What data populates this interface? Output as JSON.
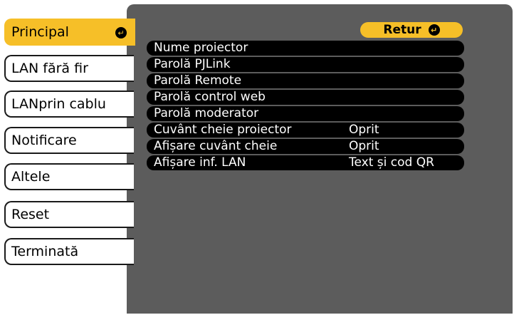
{
  "sidebar": {
    "tabs": [
      {
        "label": "Principal"
      },
      {
        "label": "LAN fără fir"
      },
      {
        "label": "LANprin cablu"
      },
      {
        "label": "Notificare"
      },
      {
        "label": "Altele"
      },
      {
        "label": "Reset"
      },
      {
        "label": "Terminată"
      }
    ],
    "selected_icon": "enter-icon"
  },
  "main": {
    "back_label": "Retur",
    "back_icon": "enter-icon",
    "rows": [
      {
        "label": "Nume proiector",
        "value": ""
      },
      {
        "label": "Parolă PJLink",
        "value": ""
      },
      {
        "label": "Parolă Remote",
        "value": ""
      },
      {
        "label": "Parolă control web",
        "value": ""
      },
      {
        "label": "Parolă moderator",
        "value": ""
      },
      {
        "label": "Cuvânt cheie proiector",
        "value": "Oprit"
      },
      {
        "label": "Afișare cuvânt cheie",
        "value": "Oprit"
      },
      {
        "label": "Afișare inf. LAN",
        "value": "Text și cod QR"
      }
    ]
  },
  "colors": {
    "accent": "#f6bf28",
    "panel": "#5c5c5c",
    "row": "#000000"
  }
}
